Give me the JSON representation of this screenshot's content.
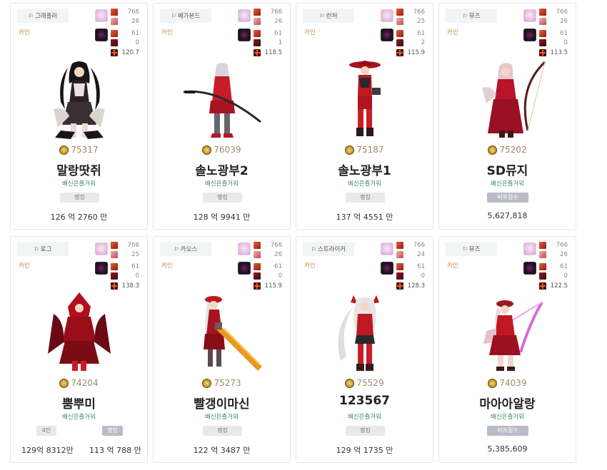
{
  "cards": [
    {
      "class_name": "그래플러",
      "server": "카인",
      "stats": [
        "766",
        "26",
        "61",
        "0"
      ],
      "stat_total": "120.7",
      "rank_score": "75317",
      "name": "말랑땃쥐",
      "guild": "배신은즐거워",
      "badges": [
        {
          "label": "랭킹",
          "value": "126 억 2760 만"
        }
      ]
    },
    {
      "class_name": "베가본드",
      "server": "카인",
      "stats": [
        "766",
        "26",
        "61",
        "1"
      ],
      "stat_total": "118.5",
      "rank_score": "76039",
      "name": "솔노광부2",
      "guild": "배신은즐거워",
      "badges": [
        {
          "label": "랭킹",
          "value": "128 억 9941 만"
        }
      ]
    },
    {
      "class_name": "런처",
      "server": "카인",
      "stats": [
        "766",
        "25",
        "61",
        "2"
      ],
      "stat_total": "115.9",
      "rank_score": "75187",
      "name": "솔노광부1",
      "guild": "배신은즐거워",
      "badges": [
        {
          "label": "랭킹",
          "value": "137 억 4551 만"
        }
      ]
    },
    {
      "class_name": "뮤즈",
      "server": "카인",
      "stats": [
        "766",
        "26",
        "61",
        "0"
      ],
      "stat_total": "113.5",
      "rank_score": "75202",
      "name": "SD뮤지",
      "guild": "배신은즐거워",
      "badges": [
        {
          "label": "버프점수",
          "value": "5,627,818"
        }
      ]
    },
    {
      "class_name": "로그",
      "server": "카인",
      "stats": [
        "766",
        "25",
        "61",
        "0"
      ],
      "stat_total": "138.3",
      "rank_score": "74204",
      "name": "뿜뿌미",
      "guild": "배신은즐거워",
      "badges": [
        {
          "label": "4인",
          "value": "129억 8312만"
        },
        {
          "label": "랭킹",
          "value": "113 억 788 만"
        }
      ]
    },
    {
      "class_name": "카오스",
      "server": "카인",
      "stats": [
        "766",
        "26",
        "61",
        "0"
      ],
      "stat_total": "115.9",
      "rank_score": "75273",
      "name": "빨갱이마신",
      "guild": "배신은즐거워",
      "badges": [
        {
          "label": "랭킹",
          "value": "122 억 3487 만"
        }
      ]
    },
    {
      "class_name": "스트라이커",
      "server": "카인",
      "stats": [
        "766",
        "24",
        "61",
        "0"
      ],
      "stat_total": "128.3",
      "rank_score": "75529",
      "name": "123567",
      "guild": "배신은즐거워",
      "badges": [
        {
          "label": "랭킹",
          "value": "129 억 1735 만"
        }
      ]
    },
    {
      "class_name": "뮤즈",
      "server": "카인",
      "stats": [
        "766",
        "26",
        "61",
        "0"
      ],
      "stat_total": "122.5",
      "rank_score": "74039",
      "name": "마아아알랑",
      "guild": "배신은즐거워",
      "badges": [
        {
          "label": "버프점수",
          "value": "5,385,609"
        }
      ]
    }
  ],
  "icons": {
    "class_tag": "flag-icon",
    "rank": "gold-medal-icon"
  },
  "colors": {
    "server": "#c28a3c",
    "guild": "#3a8a5a",
    "rank": "#a08a6a"
  }
}
